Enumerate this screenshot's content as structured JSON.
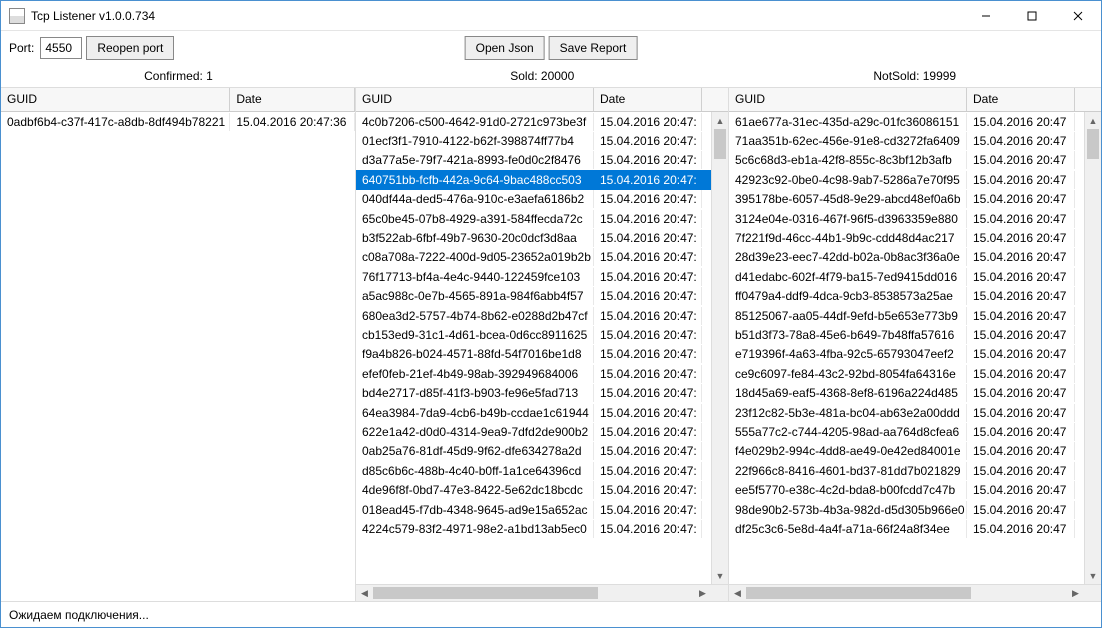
{
  "window": {
    "title": "Tcp Listener v1.0.0.734"
  },
  "toolbar": {
    "port_label": "Port:",
    "port_value": "4550",
    "reopen_label": "Reopen port",
    "open_json_label": "Open Json",
    "save_report_label": "Save Report"
  },
  "counts": {
    "confirmed_label": "Confirmed:  1",
    "sold_label": "Sold:  20000",
    "notsold_label": "NotSold:  19999"
  },
  "headers": {
    "guid": "GUID",
    "date": "Date"
  },
  "status": "Ожидаем подключения...",
  "confirmed": {
    "rows": [
      {
        "guid": "0adbf6b4-c37f-417c-a8db-8df494b78221",
        "date": "15.04.2016 20:47:36"
      }
    ]
  },
  "sold": {
    "selected_index": 3,
    "rows": [
      {
        "guid": "4c0b7206-c500-4642-91d0-2721c973be3f",
        "date": "15.04.2016 20:47:"
      },
      {
        "guid": "01ecf3f1-7910-4122-b62f-398874ff77b4",
        "date": "15.04.2016 20:47:"
      },
      {
        "guid": "d3a77a5e-79f7-421a-8993-fe0d0c2f8476",
        "date": "15.04.2016 20:47:"
      },
      {
        "guid": "640751bb-fcfb-442a-9c64-9bac488cc503",
        "date": "15.04.2016 20:47:"
      },
      {
        "guid": "040df44a-ded5-476a-910c-e3aefa6186b2",
        "date": "15.04.2016 20:47:"
      },
      {
        "guid": "65c0be45-07b8-4929-a391-584ffecda72c",
        "date": "15.04.2016 20:47:"
      },
      {
        "guid": "b3f522ab-6fbf-49b7-9630-20c0dcf3d8aa",
        "date": "15.04.2016 20:47:"
      },
      {
        "guid": "c08a708a-7222-400d-9d05-23652a019b2b",
        "date": "15.04.2016 20:47:"
      },
      {
        "guid": "76f17713-bf4a-4e4c-9440-122459fce103",
        "date": "15.04.2016 20:47:"
      },
      {
        "guid": "a5ac988c-0e7b-4565-891a-984f6abb4f57",
        "date": "15.04.2016 20:47:"
      },
      {
        "guid": "680ea3d2-5757-4b74-8b62-e0288d2b47cf",
        "date": "15.04.2016 20:47:"
      },
      {
        "guid": "cb153ed9-31c1-4d61-bcea-0d6cc8911625",
        "date": "15.04.2016 20:47:"
      },
      {
        "guid": "f9a4b826-b024-4571-88fd-54f7016be1d8",
        "date": "15.04.2016 20:47:"
      },
      {
        "guid": "efef0feb-21ef-4b49-98ab-392949684006",
        "date": "15.04.2016 20:47:"
      },
      {
        "guid": "bd4e2717-d85f-41f3-b903-fe96e5fad713",
        "date": "15.04.2016 20:47:"
      },
      {
        "guid": "64ea3984-7da9-4cb6-b49b-ccdae1c61944",
        "date": "15.04.2016 20:47:"
      },
      {
        "guid": "622e1a42-d0d0-4314-9ea9-7dfd2de900b2",
        "date": "15.04.2016 20:47:"
      },
      {
        "guid": "0ab25a76-81df-45d9-9f62-dfe634278a2d",
        "date": "15.04.2016 20:47:"
      },
      {
        "guid": "d85c6b6c-488b-4c40-b0ff-1a1ce64396cd",
        "date": "15.04.2016 20:47:"
      },
      {
        "guid": "4de96f8f-0bd7-47e3-8422-5e62dc18bcdc",
        "date": "15.04.2016 20:47:"
      },
      {
        "guid": "018ead45-f7db-4348-9645-ad9e15a652ac",
        "date": "15.04.2016 20:47:"
      },
      {
        "guid": "4224c579-83f2-4971-98e2-a1bd13ab5ec0",
        "date": "15.04.2016 20:47:"
      }
    ],
    "peek": {
      "guid": "",
      "date": ""
    }
  },
  "notsold": {
    "rows": [
      {
        "guid": "61ae677a-31ec-435d-a29c-01fc36086151",
        "date": "15.04.2016 20:47"
      },
      {
        "guid": "71aa351b-62ec-456e-91e8-cd3272fa6409",
        "date": "15.04.2016 20:47"
      },
      {
        "guid": "5c6c68d3-eb1a-42f8-855c-8c3bf12b3afb",
        "date": "15.04.2016 20:47"
      },
      {
        "guid": "42923c92-0be0-4c98-9ab7-5286a7e70f95",
        "date": "15.04.2016 20:47"
      },
      {
        "guid": "395178be-6057-45d8-9e29-abcd48ef0a6b",
        "date": "15.04.2016 20:47"
      },
      {
        "guid": "3124e04e-0316-467f-96f5-d3963359e880",
        "date": "15.04.2016 20:47"
      },
      {
        "guid": "7f221f9d-46cc-44b1-9b9c-cdd48d4ac217",
        "date": "15.04.2016 20:47"
      },
      {
        "guid": "28d39e23-eec7-42dd-b02a-0b8ac3f36a0e",
        "date": "15.04.2016 20:47"
      },
      {
        "guid": "d41edabc-602f-4f79-ba15-7ed9415dd016",
        "date": "15.04.2016 20:47"
      },
      {
        "guid": "ff0479a4-ddf9-4dca-9cb3-8538573a25ae",
        "date": "15.04.2016 20:47"
      },
      {
        "guid": "85125067-aa05-44df-9efd-b5e653e773b9",
        "date": "15.04.2016 20:47"
      },
      {
        "guid": "b51d3f73-78a8-45e6-b649-7b48ffa57616",
        "date": "15.04.2016 20:47"
      },
      {
        "guid": "e719396f-4a63-4fba-92c5-65793047eef2",
        "date": "15.04.2016 20:47"
      },
      {
        "guid": "ce9c6097-fe84-43c2-92bd-8054fa64316e",
        "date": "15.04.2016 20:47"
      },
      {
        "guid": "18d45a69-eaf5-4368-8ef8-6196a224d485",
        "date": "15.04.2016 20:47"
      },
      {
        "guid": "23f12c82-5b3e-481a-bc04-ab63e2a00ddd",
        "date": "15.04.2016 20:47"
      },
      {
        "guid": "555a77c2-c744-4205-98ad-aa764d8cfea6",
        "date": "15.04.2016 20:47"
      },
      {
        "guid": "f4e029b2-994c-4dd8-ae49-0e42ed84001e",
        "date": "15.04.2016 20:47"
      },
      {
        "guid": "22f966c8-8416-4601-bd37-81dd7b021829",
        "date": "15.04.2016 20:47"
      },
      {
        "guid": "ee5f5770-e38c-4c2d-bda8-b00fcdd7c47b",
        "date": "15.04.2016 20:47"
      },
      {
        "guid": "98de90b2-573b-4b3a-982d-d5d305b966e0",
        "date": "15.04.2016 20:47"
      },
      {
        "guid": "df25c3c6-5e8d-4a4f-a71a-66f24a8f34ee",
        "date": "15.04.2016 20:47"
      }
    ],
    "peek": {
      "guid": "",
      "date": ""
    }
  }
}
